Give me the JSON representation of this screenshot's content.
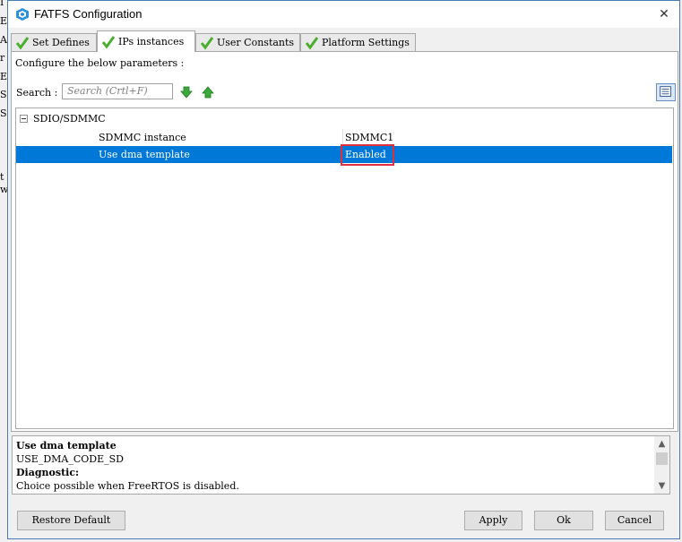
{
  "window": {
    "title": "FATFS Configuration",
    "close_glyph": "✕"
  },
  "background_left_chars": [
    "I",
    "E",
    "A",
    "r",
    "E",
    "S",
    "S",
    "t",
    "w"
  ],
  "tabs": [
    {
      "label": "Set Defines",
      "active": false
    },
    {
      "label": "IPs instances",
      "active": true
    },
    {
      "label": "User Constants",
      "active": false
    },
    {
      "label": "Platform Settings",
      "active": false
    }
  ],
  "panel": {
    "configure_text": "Configure the below parameters :",
    "search_label": "Search :",
    "search_placeholder": "Search (Crtl+F)"
  },
  "tree": {
    "group_label": "SDIO/SDMMC",
    "rows": [
      {
        "name": "SDMMC instance",
        "value": "SDMMC1",
        "selected": false
      },
      {
        "name": "Use dma template",
        "value": "Enabled",
        "selected": true
      }
    ]
  },
  "description": {
    "title": "Use dma template",
    "define": "USE_DMA_CODE_SD",
    "diag_label": "Diagnostic:",
    "diag_text": "Choice possible when FreeRTOS is disabled."
  },
  "buttons": {
    "restore": "Restore Default",
    "apply": "Apply",
    "ok": "Ok",
    "cancel": "Cancel"
  },
  "colors": {
    "selection": "#0078d7",
    "highlight_box": "#e0303b",
    "check": "#4cae2e",
    "arrow": "#3aa83a"
  },
  "icons": {
    "app": "cube-icon",
    "tab_check": "check-icon",
    "down": "arrow-down-icon",
    "up": "arrow-up-icon",
    "view": "list-view-icon"
  }
}
